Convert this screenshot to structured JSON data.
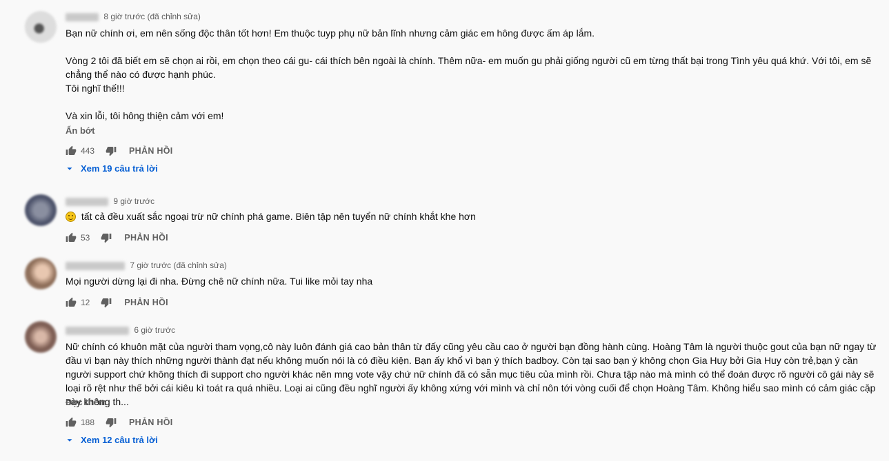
{
  "comments": [
    {
      "time": "8 giờ trước (đã chỉnh sửa)",
      "paragraphs": [
        "Bạn nữ chính ơi, em nên sống độc thân tốt hơn! Em thuộc tuyp phụ nữ bản lĩnh nhưng cảm giác em hông được ấm áp lắm.",
        "Vòng 2 tôi đã biết em sẽ chọn ai rồi, em chọn theo cái gu- cái thích bên ngoài là chính. Thêm nữa- em muốn gu phải giống người cũ em từng thất bại trong Tình yêu quá khứ. Với tôi, em sẽ chẳng thể nào có được hạnh phúc.\nTôi nghĩ thế!!!",
        "Và xin lỗi, tôi hông thiện cảm với em!"
      ],
      "toggle_label": "Ẩn bớt",
      "likes": "443",
      "reply_label": "PHẢN HỒI",
      "view_replies": "Xem 19 câu trả lời"
    },
    {
      "time": "9 giờ trước",
      "paragraphs": [
        "tất cả đều xuất sắc ngoại trừ nữ chính phá game. Biên tập nên tuyển nữ chính khắt khe hơn"
      ],
      "likes": "53",
      "reply_label": "PHẢN HỒI"
    },
    {
      "time": "7 giờ trước (đã chỉnh sửa)",
      "paragraphs": [
        "Mọi người dừng lại đi nha. Đừng chê nữ chính nữa. Tui like mỏi tay nha"
      ],
      "likes": "12",
      "reply_label": "PHẢN HỒI"
    },
    {
      "time": "6 giờ trước",
      "paragraphs": [
        "Nữ chính có khuôn mặt của người tham vọng,cô này luôn đánh giá cao bản thân từ đấy cũng yêu cầu cao ở người bạn đồng hành cùng. Hoàng Tâm là người thuộc gout của bạn nữ ngay từ đầu vì bạn này thích những người thành đạt nếu không muốn nói là có điều kiện. Bạn ấy khổ vì bạn ý thích badboy. Còn tại sao bạn ý không chọn Gia Huy bởi Gia Huy còn trẻ,bạn ý cần người support chứ không thích đi support cho người khác nên mng vote vậy chứ nữ chính đã có sẵn mục tiêu của mình rồi. Chưa tập nào mà mình có thể đoán được rõ người cô gái này sẽ loại rõ rệt như thế bởi cái kiêu kì toát ra quá nhiều. Loại ai cũng đều nghĩ người ấy không xứng với mình và chỉ nôn tới vòng cuối để chọn Hoàng Tâm. Không hiểu sao mình có cảm giác cặp này không th..."
      ],
      "toggle_label": "Đọc thêm",
      "likes": "188",
      "reply_label": "PHẢN HỒI",
      "view_replies": "Xem 12 câu trả lời"
    }
  ],
  "colors": {
    "link": "#065fd4",
    "meta": "#606060",
    "text": "#0f0f0f",
    "background": "#f9f9f9"
  },
  "icons": [
    "like-icon",
    "dislike-icon",
    "caret-down-icon",
    "smiley-emoji-icon"
  ]
}
